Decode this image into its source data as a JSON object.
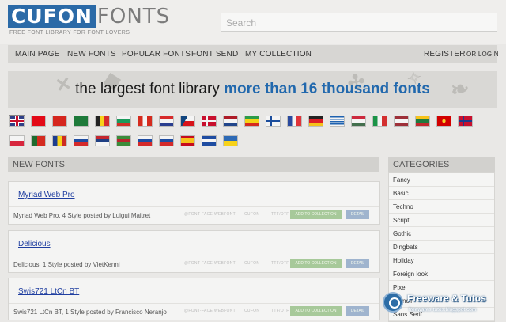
{
  "header": {
    "logo_box": "CUFON",
    "logo_rest": "FONTS",
    "tagline": "FREE FONT LIBRARY FOR FONT LOVERS",
    "search_placeholder": "Search"
  },
  "nav": {
    "items": [
      "MAIN PAGE",
      "NEW FONTS",
      "POPULAR FONTS",
      "FONT SEND",
      "MY COLLECTION"
    ],
    "register": "REGISTER",
    "login": "OR LOGIN"
  },
  "banner": {
    "text_a": "the largest font library",
    "text_b": "more than 16 thousand fonts"
  },
  "flags": [
    {
      "name": "uk",
      "colors": [
        "#2f3f86",
        "#c8102e"
      ],
      "type": "uk"
    },
    {
      "name": "turkey",
      "colors": [
        "#e30a17",
        "#e30a17"
      ],
      "type": "solid"
    },
    {
      "name": "albania",
      "colors": [
        "#d5261e",
        "#d5261e"
      ],
      "type": "solid"
    },
    {
      "name": "saudi",
      "colors": [
        "#1e7a3a",
        "#1e7a3a"
      ],
      "type": "solid"
    },
    {
      "name": "belgium",
      "colors": [
        "#222222",
        "#f7d21a",
        "#d62c2c"
      ],
      "type": "vert"
    },
    {
      "name": "bulgaria",
      "colors": [
        "#f4f4f4",
        "#1b9a5b",
        "#d22f27"
      ],
      "type": "horiz"
    },
    {
      "name": "canada",
      "colors": [
        "#d52b1e",
        "#f4f4f4",
        "#d52b1e"
      ],
      "type": "vert"
    },
    {
      "name": "croatia",
      "colors": [
        "#d72a2a",
        "#f4f4f4",
        "#2a3e8f"
      ],
      "type": "horiz"
    },
    {
      "name": "czech",
      "colors": [
        "#f4f4f4",
        "#d7141a",
        "#11457e"
      ],
      "type": "czech"
    },
    {
      "name": "denmark",
      "colors": [
        "#c8102e",
        "#f4f4f4"
      ],
      "type": "cross"
    },
    {
      "name": "netherlands",
      "colors": [
        "#ae1c28",
        "#f4f4f4",
        "#21468b"
      ],
      "type": "horiz"
    },
    {
      "name": "ethiopia",
      "colors": [
        "#2c9c48",
        "#f5d316",
        "#d52a1f"
      ],
      "type": "horiz"
    },
    {
      "name": "finland",
      "colors": [
        "#f4f4f4",
        "#1b4d9c"
      ],
      "type": "cross"
    },
    {
      "name": "france",
      "colors": [
        "#2a4a9e",
        "#f4f4f4",
        "#e0343a"
      ],
      "type": "vert"
    },
    {
      "name": "germany",
      "colors": [
        "#222222",
        "#dd1f26",
        "#f4c21b"
      ],
      "type": "horiz"
    },
    {
      "name": "greece",
      "colors": [
        "#1e62b0",
        "#f4f4f4",
        "#1e62b0"
      ],
      "type": "stripes"
    },
    {
      "name": "hungary",
      "colors": [
        "#cd2a3e",
        "#f4f4f4",
        "#436f4d"
      ],
      "type": "horiz"
    },
    {
      "name": "italy",
      "colors": [
        "#1b9347",
        "#f4f4f4",
        "#d32f2f"
      ],
      "type": "vert"
    },
    {
      "name": "latvia",
      "colors": [
        "#9e3039",
        "#f4f4f4",
        "#9e3039"
      ],
      "type": "horiz"
    },
    {
      "name": "lithuania",
      "colors": [
        "#f7c31b",
        "#1f7a3e",
        "#c2272d"
      ],
      "type": "horiz"
    },
    {
      "name": "macedonia",
      "colors": [
        "#d20000",
        "#f7d12a"
      ],
      "type": "sun"
    },
    {
      "name": "norway",
      "colors": [
        "#c8102e",
        "#1e3a8a"
      ],
      "type": "cross"
    },
    {
      "name": "poland",
      "colors": [
        "#f4f4f4",
        "#d7263d"
      ],
      "type": "horiz2"
    },
    {
      "name": "portugal",
      "colors": [
        "#1e6b2e",
        "#d42a1f",
        "#d42a1f"
      ],
      "type": "vert2"
    },
    {
      "name": "romania",
      "colors": [
        "#1e3d8f",
        "#f8d21a",
        "#cc2b22"
      ],
      "type": "vert"
    },
    {
      "name": "russia",
      "colors": [
        "#f4f4f4",
        "#1e4ca1",
        "#d42a2a"
      ],
      "type": "horiz"
    },
    {
      "name": "serbia",
      "colors": [
        "#c4272e",
        "#1f3f83",
        "#f4f4f4"
      ],
      "type": "horiz"
    },
    {
      "name": "suriname",
      "colors": [
        "#3b8c3a",
        "#b7252c",
        "#3b8c3a"
      ],
      "type": "horiz"
    },
    {
      "name": "slovakia",
      "colors": [
        "#f4f4f4",
        "#1e4ca1",
        "#d42a2a"
      ],
      "type": "horiz"
    },
    {
      "name": "slovenia",
      "colors": [
        "#f4f4f4",
        "#1e4ca1",
        "#d42a2a"
      ],
      "type": "horiz"
    },
    {
      "name": "spain",
      "colors": [
        "#c60b1e",
        "#f7c21b",
        "#c60b1e"
      ],
      "type": "spain"
    },
    {
      "name": "el-salvador",
      "colors": [
        "#1e4ca1",
        "#f4f4f4",
        "#1e4ca1"
      ],
      "type": "horiz"
    },
    {
      "name": "ukraine",
      "colors": [
        "#2e6ab5",
        "#f7d21a"
      ],
      "type": "horiz2"
    }
  ],
  "new_fonts": {
    "heading": "NEW FONTS",
    "mini_labels": [
      "@FONT-FACE WEBFONT",
      "CUFON",
      "TTF/OTF"
    ],
    "add_label": "ADD TO COLLECTION",
    "detail_label": "DETAIL",
    "items": [
      {
        "title": "Myriad Web Pro",
        "meta": "Myriad Web Pro, 4 Style posted by Luigui Maitret"
      },
      {
        "title": "Delicious",
        "meta": "Delicious, 1 Style posted by VietKenni"
      },
      {
        "title": "Swis721 LtCn BT",
        "meta": "Swis721 LtCn BT, 1 Style posted by Francisco Neranjo"
      }
    ]
  },
  "categories": {
    "heading": "CATEGORIES",
    "items": [
      "Fancy",
      "Basic",
      "Techno",
      "Script",
      "Gothic",
      "Dingbats",
      "Holiday",
      "Foreign look",
      "Pixel",
      "Stencil",
      "Sans Serif"
    ]
  },
  "watermark": {
    "title": "Freeware & Tutos",
    "url": "freewares-tutos.blogspot.com"
  }
}
